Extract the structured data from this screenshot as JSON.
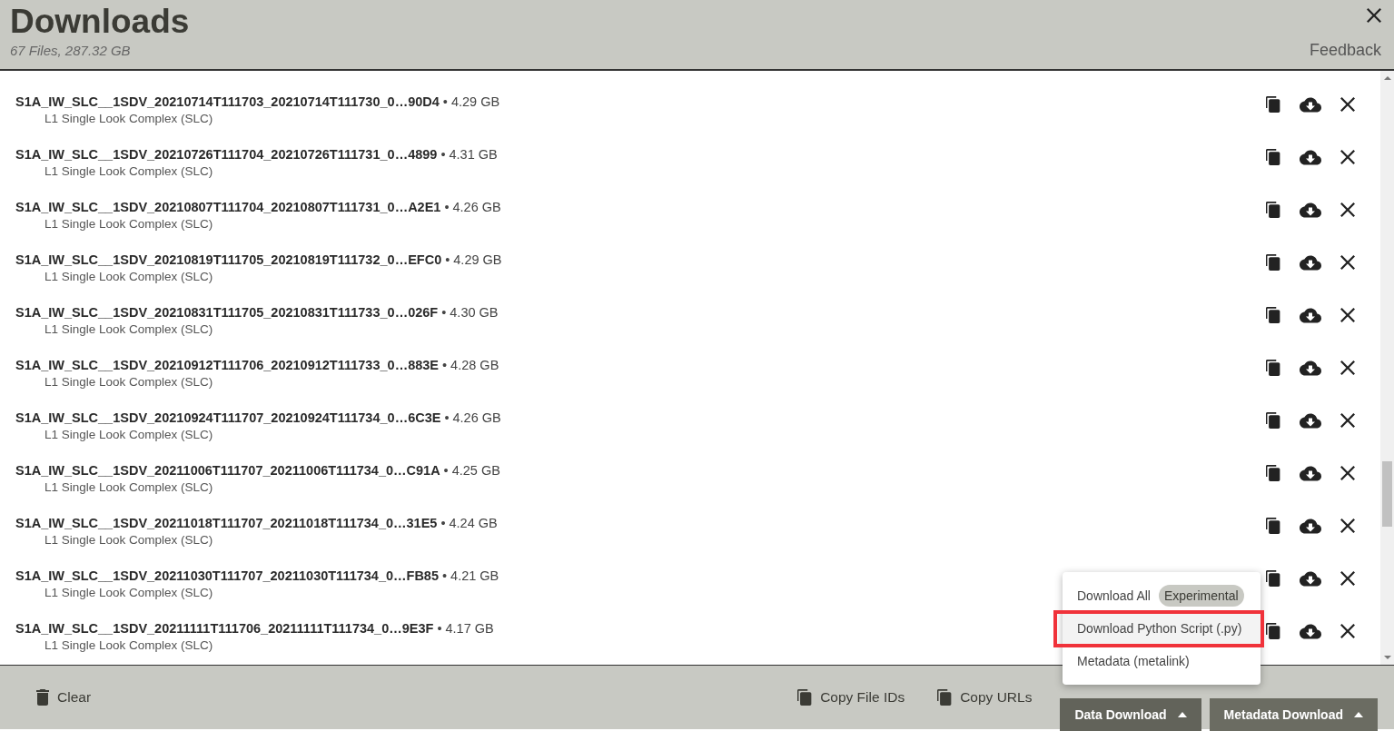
{
  "header": {
    "title": "Downloads",
    "summary": "67 Files, 287.32 GB",
    "feedback": "Feedback"
  },
  "files": [
    {
      "kind": "partial"
    },
    {
      "kind": "full",
      "name": "S1A_IW_SLC__1SDV_20210714T111703_20210714T111730_0…90D4",
      "size": "• 4.29 GB",
      "product": "L1 Single Look Complex (SLC)"
    },
    {
      "kind": "full",
      "name": "S1A_IW_SLC__1SDV_20210726T111704_20210726T111731_0…4899",
      "size": "• 4.31 GB",
      "product": "L1 Single Look Complex (SLC)"
    },
    {
      "kind": "full",
      "name": "S1A_IW_SLC__1SDV_20210807T111704_20210807T111731_0…A2E1",
      "size": "• 4.26 GB",
      "product": "L1 Single Look Complex (SLC)"
    },
    {
      "kind": "full",
      "name": "S1A_IW_SLC__1SDV_20210819T111705_20210819T111732_0…EFC0",
      "size": "• 4.29 GB",
      "product": "L1 Single Look Complex (SLC)"
    },
    {
      "kind": "full",
      "name": "S1A_IW_SLC__1SDV_20210831T111705_20210831T111733_0…026F",
      "size": "• 4.30 GB",
      "product": "L1 Single Look Complex (SLC)"
    },
    {
      "kind": "full",
      "name": "S1A_IW_SLC__1SDV_20210912T111706_20210912T111733_0…883E",
      "size": "• 4.28 GB",
      "product": "L1 Single Look Complex (SLC)"
    },
    {
      "kind": "full",
      "name": "S1A_IW_SLC__1SDV_20210924T111707_20210924T111734_0…6C3E",
      "size": "• 4.26 GB",
      "product": "L1 Single Look Complex (SLC)"
    },
    {
      "kind": "full",
      "name": "S1A_IW_SLC__1SDV_20211006T111707_20211006T111734_0…C91A",
      "size": "• 4.25 GB",
      "product": "L1 Single Look Complex (SLC)"
    },
    {
      "kind": "full",
      "name": "S1A_IW_SLC__1SDV_20211018T111707_20211018T111734_0…31E5",
      "size": "• 4.24 GB",
      "product": "L1 Single Look Complex (SLC)"
    },
    {
      "kind": "full",
      "name": "S1A_IW_SLC__1SDV_20211030T111707_20211030T111734_0…FB85",
      "size": "• 4.21 GB",
      "product": "L1 Single Look Complex (SLC)"
    },
    {
      "kind": "full",
      "name": "S1A_IW_SLC__1SDV_20211111T111706_20211111T111734_0…9E3F",
      "size": "• 4.17 GB",
      "product": "L1 Single Look Complex (SLC)"
    }
  ],
  "footer": {
    "clear": "Clear",
    "copy_ids": "Copy File IDs",
    "copy_urls": "Copy URLs",
    "data_download": {
      "label": "Data Download",
      "expanded": true
    },
    "metadata_download": {
      "label": "Metadata Download"
    }
  },
  "menu": [
    {
      "label": "Download All",
      "badge": "Experimental",
      "selected": false,
      "highlighted": false
    },
    {
      "label": "Download Python Script (.py)",
      "selected": true,
      "highlighted": true
    },
    {
      "label": "Metadata (metalink)",
      "selected": false,
      "highlighted": false
    }
  ]
}
